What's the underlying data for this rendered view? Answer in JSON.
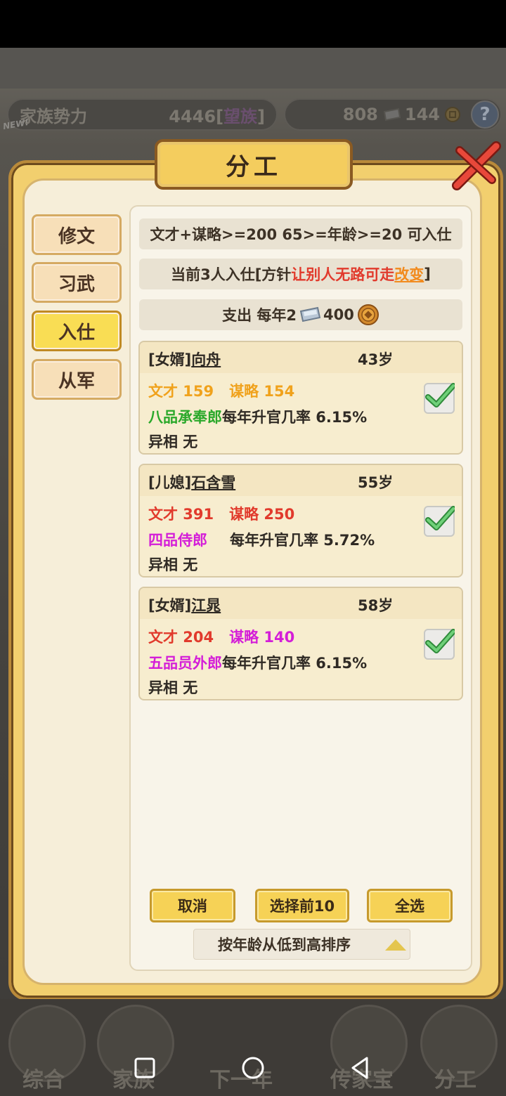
{
  "top_bar": {
    "family_power_label": "家族势力",
    "family_power_value": "4446",
    "family_power_rank": "望族",
    "silver": "808",
    "copper": "144",
    "help_label": "?",
    "new_badge": "NEW!"
  },
  "dialog": {
    "title": "分工",
    "side_tabs": [
      {
        "label": "修文",
        "active": false
      },
      {
        "label": "习武",
        "active": false
      },
      {
        "label": "入仕",
        "active": true
      },
      {
        "label": "从军",
        "active": false
      }
    ],
    "requirement": "文才+谋略>=200 65>=年龄>=20 可入仕",
    "current_prefix": "当前3人入仕[方针",
    "current_policy": "让别人无路可走",
    "current_change": "改变",
    "current_suffix": "]",
    "expense_prefix": "支出 每年2",
    "expense_amount": "400",
    "cards": [
      {
        "relation": "[女婿]",
        "name": "向舟",
        "age": "43岁",
        "wencai": "文才 159",
        "moulue": "谋略 154",
        "wencai_color": "#f0a21c",
        "moulue_color": "#f0a21c",
        "rank": "八品承奉郎",
        "rank_color": "#2aa82a",
        "promo": "每年升官几率 6.15%",
        "trait": "异相 无",
        "checked": true
      },
      {
        "relation": "[儿媳]",
        "name": "石含雪",
        "age": "55岁",
        "wencai": "文才 391",
        "moulue": "谋略 250",
        "wencai_color": "#e13a2c",
        "moulue_color": "#e13a2c",
        "rank": "四品侍郎",
        "rank_color": "#d41ed8",
        "promo": "每年升官几率 5.72%",
        "trait": "异相 无",
        "checked": true
      },
      {
        "relation": "[女婿]",
        "name": "江晁",
        "age": "58岁",
        "wencai": "文才 204",
        "moulue": "谋略 140",
        "wencai_color": "#e13a2c",
        "moulue_color": "#d41ed8",
        "rank": "五品员外郎",
        "rank_color": "#d41ed8",
        "promo": "每年升官几率 6.15%",
        "trait": "异相 无",
        "checked": true
      }
    ],
    "buttons": {
      "cancel": "取消",
      "select_top10": "选择前10",
      "select_all": "全选"
    },
    "sort_label": "按年龄从低到高排序"
  },
  "game_nav": [
    "综合",
    "家族",
    "下一年",
    "传家宝",
    "分工"
  ],
  "colors": {
    "accent_gold": "#f6d256",
    "policy_red": "#e13a2c",
    "change_orange": "#f28a1c"
  }
}
